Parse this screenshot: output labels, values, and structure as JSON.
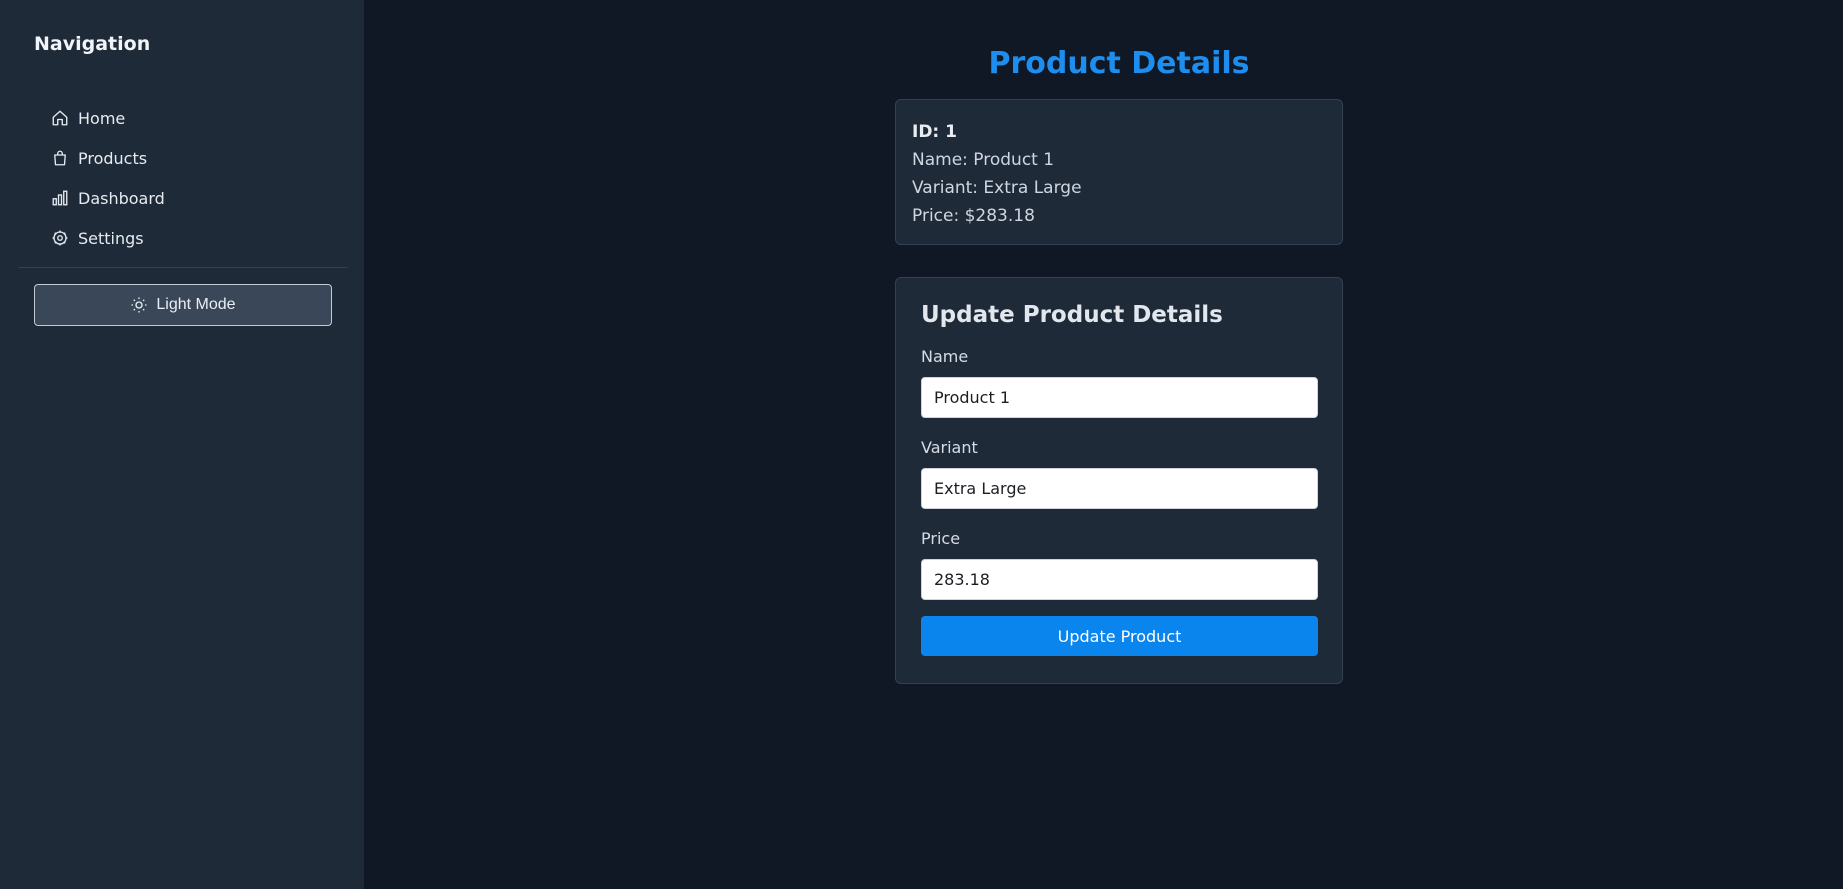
{
  "sidebar": {
    "title": "Navigation",
    "items": [
      {
        "label": "Home",
        "icon": "home-icon"
      },
      {
        "label": "Products",
        "icon": "shopping-bag-icon"
      },
      {
        "label": "Dashboard",
        "icon": "bar-chart-icon"
      },
      {
        "label": "Settings",
        "icon": "gear-icon"
      }
    ],
    "mode_button": {
      "label": "Light Mode",
      "icon": "sun-icon"
    }
  },
  "main": {
    "title": "Product Details",
    "details": {
      "id_line": "ID: 1",
      "name_line": "Name: Product 1",
      "variant_line": "Variant: Extra Large",
      "price_line": "Price: $283.18"
    },
    "form": {
      "title": "Update Product Details",
      "name_label": "Name",
      "name_value": "Product 1",
      "variant_label": "Variant",
      "variant_value": "Extra Large",
      "price_label": "Price",
      "price_value": "283.18",
      "submit_label": "Update Product"
    }
  },
  "colors": {
    "background": "#0f1824",
    "sidebar": "#1f2a38",
    "accent": "#1d8ef0",
    "button": "#0a85ee"
  }
}
